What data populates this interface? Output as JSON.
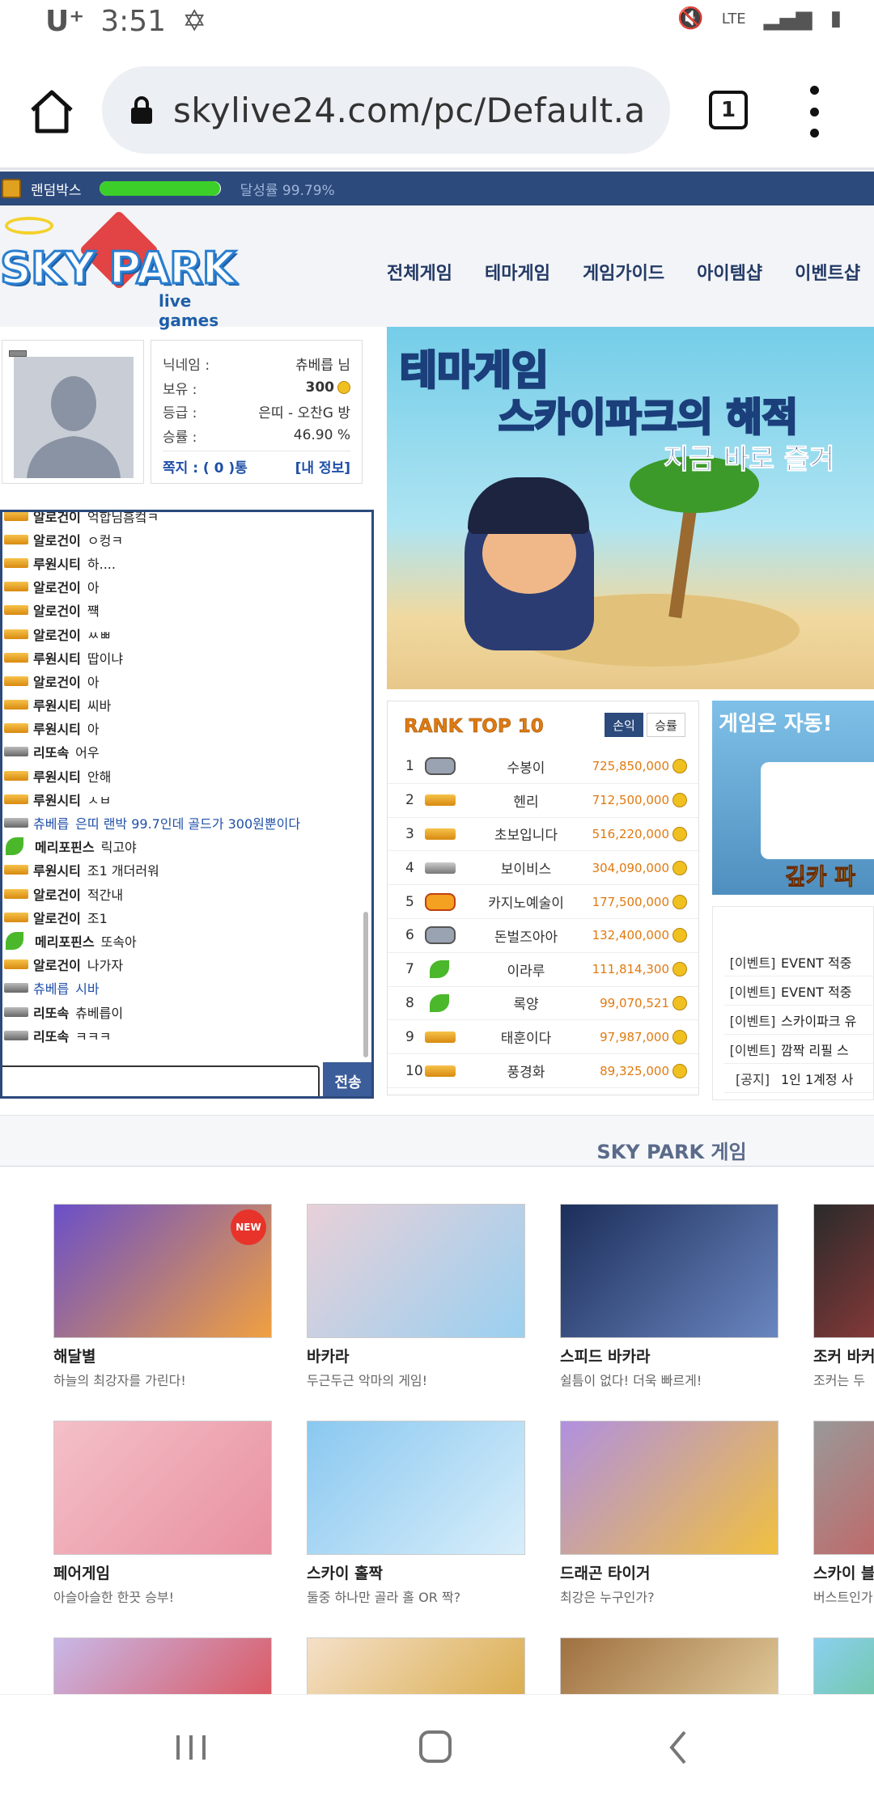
{
  "status_bar": {
    "carrier": "U⁺",
    "time": "3:51",
    "network": "LTE"
  },
  "browser": {
    "url": "skylive24.com/pc/Default.a",
    "tab_count": "1"
  },
  "top_strip": {
    "randombox_label": "랜덤박스",
    "progress_fraction": 0.9979,
    "rate_label": "달성률",
    "rate_value": "99.79%"
  },
  "logo": {
    "main": "SKY PARK",
    "sub": "live games"
  },
  "nav": [
    "전체게임",
    "테마게임",
    "게임가이드",
    "아이템샵",
    "이벤트샵"
  ],
  "profile": {
    "rows": [
      {
        "label": "닉네임 :",
        "value": "츄베릅 님"
      },
      {
        "label": "보유 :",
        "value": "300"
      },
      {
        "label": "등급 :",
        "value": "은띠 - 오찬G 방"
      },
      {
        "label": "승률 :",
        "value": "46.90 %"
      }
    ],
    "mail_link": "쪽지 : ( 0 )통",
    "myinfo_link": "[내 정보]"
  },
  "chat": {
    "lines": [
      {
        "icon": "gold",
        "nick": "알로건이",
        "msg": "억합님흠컼ㅋ"
      },
      {
        "icon": "gold",
        "nick": "알로건이",
        "msg": "ㅇ컹ㅋ"
      },
      {
        "icon": "gold",
        "nick": "루원시티",
        "msg": "하...."
      },
      {
        "icon": "gold",
        "nick": "알로건이",
        "msg": "아"
      },
      {
        "icon": "gold",
        "nick": "알로건이",
        "msg": "쨱"
      },
      {
        "icon": "gold",
        "nick": "알로건이",
        "msg": "ㅆㅃ"
      },
      {
        "icon": "gold",
        "nick": "루원시티",
        "msg": "땁이냐"
      },
      {
        "icon": "gold",
        "nick": "알로건이",
        "msg": "아"
      },
      {
        "icon": "gold",
        "nick": "루원시티",
        "msg": "씨바"
      },
      {
        "icon": "gold",
        "nick": "루원시티",
        "msg": "아"
      },
      {
        "icon": "silver",
        "nick": "리또속",
        "msg": "어우"
      },
      {
        "icon": "gold",
        "nick": "루원시티",
        "msg": "안해"
      },
      {
        "icon": "gold",
        "nick": "루원시티",
        "msg": "ㅅㅂ"
      },
      {
        "icon": "silver",
        "nick": "츄베릅",
        "msg": "은띠 랜박 99.7인데 골드가 300원뿐이다",
        "me": true
      },
      {
        "icon": "leaf",
        "nick": "메리포핀스",
        "msg": "릭고야"
      },
      {
        "icon": "gold",
        "nick": "루원시티",
        "msg": "조1 개더러워"
      },
      {
        "icon": "gold",
        "nick": "알로건이",
        "msg": "적간내"
      },
      {
        "icon": "gold",
        "nick": "알로건이",
        "msg": "조1"
      },
      {
        "icon": "leaf",
        "nick": "메리포핀스",
        "msg": "또속아"
      },
      {
        "icon": "gold",
        "nick": "알로건이",
        "msg": "나가자"
      },
      {
        "icon": "silver",
        "nick": "츄베릅",
        "msg": "시바",
        "me": true
      },
      {
        "icon": "silver",
        "nick": "리또속",
        "msg": "츄베릅이"
      },
      {
        "icon": "silver",
        "nick": "리또속",
        "msg": "ㅋㅋㅋ"
      }
    ],
    "send_label": "전송"
  },
  "banner": {
    "title1": "테마게임",
    "title2_a": "스카이파크의 ",
    "title2_b": "해적",
    "title3": "지금 바로 즐겨"
  },
  "rank": {
    "title": "RANK TOP 10",
    "tab_active": "손익",
    "tab_inactive": "승률",
    "rows": [
      {
        "no": "1",
        "icon": "badge",
        "name": "수봉이",
        "score": "725,850,000"
      },
      {
        "no": "2",
        "icon": "gold",
        "name": "헨리",
        "score": "712,500,000"
      },
      {
        "no": "3",
        "icon": "gold",
        "name": "초보입니다",
        "score": "516,220,000"
      },
      {
        "no": "4",
        "icon": "silver",
        "name": "보이비스",
        "score": "304,090,000"
      },
      {
        "no": "5",
        "icon": "fire",
        "name": "카지노예술이",
        "score": "177,500,000"
      },
      {
        "no": "6",
        "icon": "badge",
        "name": "돈벌즈아아",
        "score": "132,400,000"
      },
      {
        "no": "7",
        "icon": "leaf",
        "name": "이라루",
        "score": "111,814,300"
      },
      {
        "no": "8",
        "icon": "leaf",
        "name": "록양",
        "score": "99,070,521"
      },
      {
        "no": "9",
        "icon": "gold",
        "name": "태훈이다",
        "score": "97,987,000"
      },
      {
        "no": "10",
        "icon": "gold",
        "name": "풍경화",
        "score": "89,325,000"
      }
    ]
  },
  "promo": {
    "title": "게임은 자동!",
    "sub": "깊카 파밍"
  },
  "notices": [
    {
      "tag": "[이벤트]",
      "text": "EVENT 적중"
    },
    {
      "tag": "[이벤트]",
      "text": "EVENT 적중"
    },
    {
      "tag": "[이벤트]",
      "text": "스카이파크 유"
    },
    {
      "tag": "[이벤트]",
      "text": "깜짝 리필 스"
    },
    {
      "tag": "[공지]",
      "text": "1인 1계정 사"
    }
  ],
  "games_section": {
    "title": "SKY PARK 게임"
  },
  "games": [
    {
      "name": "해달별",
      "desc": "하늘의 최강자를 가린다!",
      "new": "NEW"
    },
    {
      "name": "바카라",
      "desc": "두근두근 악마의 게임!"
    },
    {
      "name": "스피드 바카라",
      "desc": "쉴틈이 없다! 더욱 빠르게!"
    },
    {
      "name": "조커 바커",
      "desc": "조커는 두"
    },
    {
      "name": "페어게임",
      "desc": "아슬아슬한 한끗 승부!"
    },
    {
      "name": "스카이 홀짝",
      "desc": "둘중 하나만 골라 홀 OR 짝?"
    },
    {
      "name": "드래곤 타이거",
      "desc": "최강은 누구인가?"
    },
    {
      "name": "스카이 블",
      "desc": "버스트인가"
    }
  ],
  "colors": {
    "brand_blue": "#2c4a7c",
    "accent_orange": "#e07a10",
    "progress_green": "#3ccf2a",
    "link_blue": "#1f4fa8"
  }
}
